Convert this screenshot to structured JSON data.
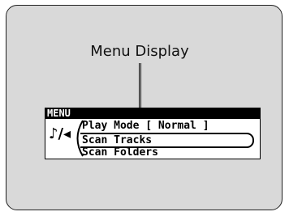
{
  "callout": {
    "label": "Menu Display"
  },
  "display": {
    "title": "MENU",
    "icon": "music-note-icon",
    "icon_glyph": "♪/◂",
    "items": [
      {
        "label": "Play Mode [ Normal ]",
        "selected": false
      },
      {
        "label": "Scan Tracks",
        "selected": true
      },
      {
        "label": "Scan Folders",
        "selected": false
      }
    ]
  }
}
